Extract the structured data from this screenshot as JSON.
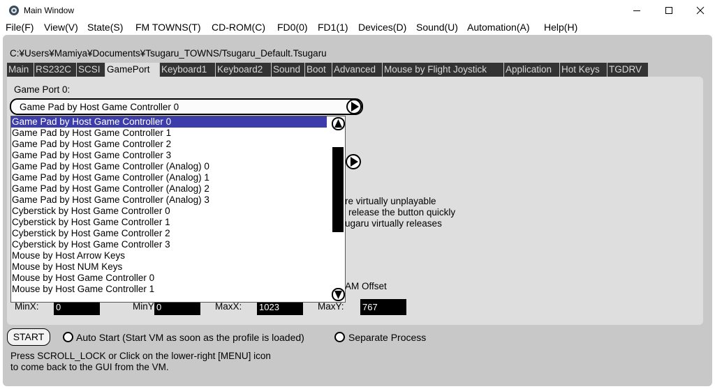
{
  "window": {
    "title": "Main Window"
  },
  "titlebar_buttons": [
    "minimize",
    "maximize",
    "close"
  ],
  "menu": [
    "File(F)",
    "View(V)",
    "State(S)",
    "FM TOWNS(T)",
    "CD-ROM(C)",
    "FD0(0)",
    "FD1(1)",
    "Devices(D)",
    "Sound(U)",
    "Automation(A)",
    "Help(H)"
  ],
  "profile_path": "C:¥Users¥Mamiya¥Documents¥Tsugaru_TOWNS/Tsugaru_Default.Tsugaru",
  "tabs": [
    "Main",
    "RS232C",
    "SCSI",
    "GamePort",
    "Keyboard1",
    "Keyboard2",
    "Sound",
    "Boot",
    "Advanced",
    "Mouse by Flight Joystick",
    "Application",
    "Hot Keys",
    "TGDRV"
  ],
  "active_tab": "GamePort",
  "gameport": {
    "label": "Game Port 0:",
    "selected": "Game Pad by Host Game Controller 0",
    "options": [
      "Game Pad by Host Game Controller 0",
      "Game Pad by Host Game Controller 1",
      "Game Pad by Host Game Controller 2",
      "Game Pad by Host Game Controller 3",
      "Game Pad by Host Game Controller (Analog) 0",
      "Game Pad by Host Game Controller (Analog) 1",
      "Game Pad by Host Game Controller (Analog) 2",
      "Game Pad by Host Game Controller (Analog) 3",
      "Cyberstick by Host Game Controller 0",
      "Cyberstick by Host Game Controller 1",
      "Cyberstick by Host Game Controller 2",
      "Cyberstick by Host Game Controller 3",
      "Mouse by Host Arrow Keys",
      "Mouse by Host NUM Keys",
      "Mouse by Host Game Controller 0",
      "Mouse by Host Game Controller 1"
    ]
  },
  "background_text": {
    "line1": "re virtually unplayable",
    "line2": "release the button quickly",
    "line3": "ugaru virtually releases",
    "offset_label": "AM Offset"
  },
  "mouse_range": {
    "minx_label": "MinX:",
    "minx": "0",
    "miny_label": "MinY:",
    "miny": "0",
    "maxx_label": "MaxX:",
    "maxx": "1023",
    "maxy_label": "MaxY:",
    "maxy": "767"
  },
  "bottom": {
    "start_label": "START",
    "auto_start_label": "Auto Start (Start VM as soon as the profile is loaded)",
    "separate_process_label": "Separate Process",
    "help_line1": "Press SCROLL_LOCK or Click on the lower-right [MENU] icon",
    "help_line2": "to come back to the GUI from the VM."
  },
  "colors": {
    "selection": "#3c3caa",
    "tab_background": "#333333",
    "client_background": "#c8c8c8"
  }
}
